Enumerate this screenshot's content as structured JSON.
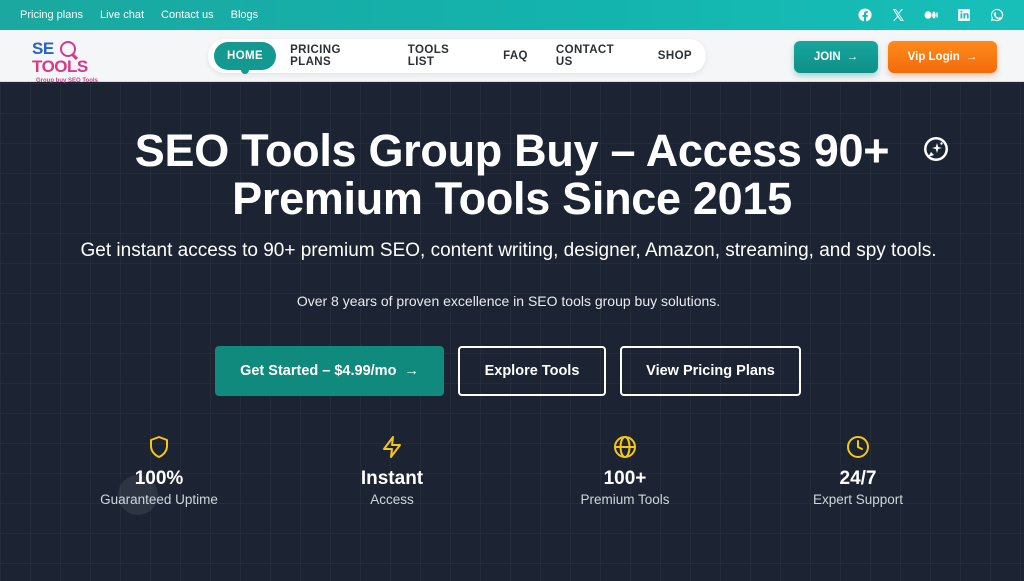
{
  "topbar": {
    "links": [
      "Pricing plans",
      "Live chat",
      "Contact us",
      "Blogs"
    ],
    "socials": [
      "facebook-icon",
      "x-icon",
      "medium-icon",
      "linkedin-icon",
      "whatsapp-icon"
    ]
  },
  "logo": {
    "part1": "SE",
    "part2": "TOOLS",
    "tagline": "Group buy SEO Tools"
  },
  "nav": {
    "items": [
      "HOME",
      "PRICING PLANS",
      "TOOLS LIST",
      "FAQ",
      "CONTACT US",
      "SHOP"
    ],
    "join": "JOIN",
    "vip": "Vip Login"
  },
  "hero": {
    "title_line1": "SEO Tools Group Buy – Access 90+",
    "title_line2": "Premium Tools Since 2015",
    "subtitle": "Get instant access to 90+ premium SEO, content writing, designer, Amazon, streaming, and spy tools.",
    "tagline": "Over 8 years of proven excellence in SEO tools group buy solutions.",
    "cta_primary": "Get Started – $4.99/mo",
    "cta_explore": "Explore Tools",
    "cta_pricing": "View Pricing Plans"
  },
  "stats": [
    {
      "icon": "shield-icon",
      "value": "100%",
      "label": "Guaranteed Uptime"
    },
    {
      "icon": "lightning-icon",
      "value": "Instant",
      "label": "Access"
    },
    {
      "icon": "globe-icon",
      "value": "100+",
      "label": "Premium Tools"
    },
    {
      "icon": "clock-icon",
      "value": "24/7",
      "label": "Expert Support"
    }
  ],
  "colors": {
    "teal": "#13998f",
    "orange": "#f26b0c",
    "hero_bg": "#1c2433",
    "stat_icon": "#f5c518"
  }
}
